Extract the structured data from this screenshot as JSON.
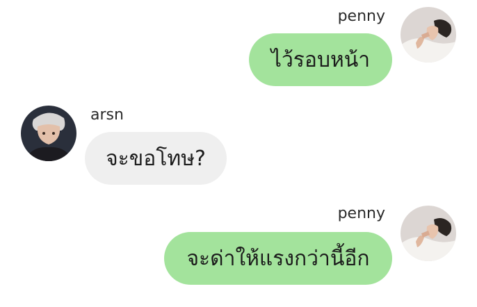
{
  "messages": [
    {
      "sender": "penny",
      "text": "ไว้รอบหน้า"
    },
    {
      "sender": "arsn",
      "text": "จะขอโทษ?"
    },
    {
      "sender": "penny",
      "text": "จะด่าให้แรงกว่านี้อีก"
    }
  ],
  "colors": {
    "outgoing_bubble": "#a3e39c",
    "incoming_bubble": "#efefef",
    "background": "#ffffff"
  }
}
